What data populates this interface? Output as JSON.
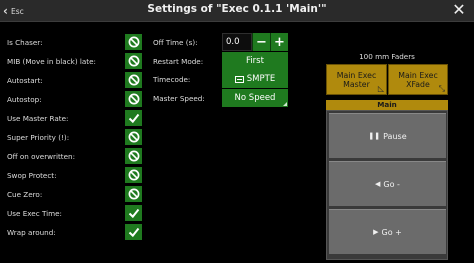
{
  "header": {
    "back_icon": "chevron-left-icon",
    "esc_label": "Esc",
    "title": "Settings of \"Exec 0.1.1 'Main'\"",
    "close_icon": "close-icon"
  },
  "options": [
    {
      "label": "Is Chaser:",
      "state": "off"
    },
    {
      "label": "MIB (Move in black) late:",
      "state": "off"
    },
    {
      "label": "Autostart:",
      "state": "off"
    },
    {
      "label": "Autostop:",
      "state": "off"
    },
    {
      "label": "Use Master Rate:",
      "state": "on"
    },
    {
      "label": "Super Priority (!):",
      "state": "off"
    },
    {
      "label": "Off on overwritten:",
      "state": "off"
    },
    {
      "label": "Swop Protect:",
      "state": "off"
    },
    {
      "label": "Cue Zero:",
      "state": "off"
    },
    {
      "label": "Use Exec Time:",
      "state": "on"
    },
    {
      "label": "Wrap around:",
      "state": "on"
    }
  ],
  "fields": {
    "off_time": {
      "label": "Off Time (s):",
      "value": "0.0",
      "minus": "−",
      "plus": "+"
    },
    "restart_mode": {
      "label": "Restart Mode:",
      "value": "First"
    },
    "timecode": {
      "label": "Timecode:",
      "value": "SMPTE",
      "icon": "timecode-icon"
    },
    "master_speed": {
      "label": "Master Speed:",
      "value": "No Speed",
      "icon": "dropdown-arrow-icon"
    }
  },
  "faders": {
    "label": "100 mm Faders",
    "master": {
      "line1": "Main Exec",
      "line2": "Master"
    },
    "xfade": {
      "line1": "Main Exec",
      "line2": "XFade"
    }
  },
  "main_panel": {
    "title": "Main",
    "pause": {
      "label": "Pause",
      "icon": "pause-icon"
    },
    "go_minus": {
      "label": "Go -",
      "icon": "triangle-left-icon"
    },
    "go_plus": {
      "label": "Go +",
      "icon": "triangle-right-icon"
    }
  },
  "colors": {
    "toggle_green": "#1f7a1f",
    "fader_gold": "#b08a0d",
    "exec_grey": "#6b6b6b"
  }
}
